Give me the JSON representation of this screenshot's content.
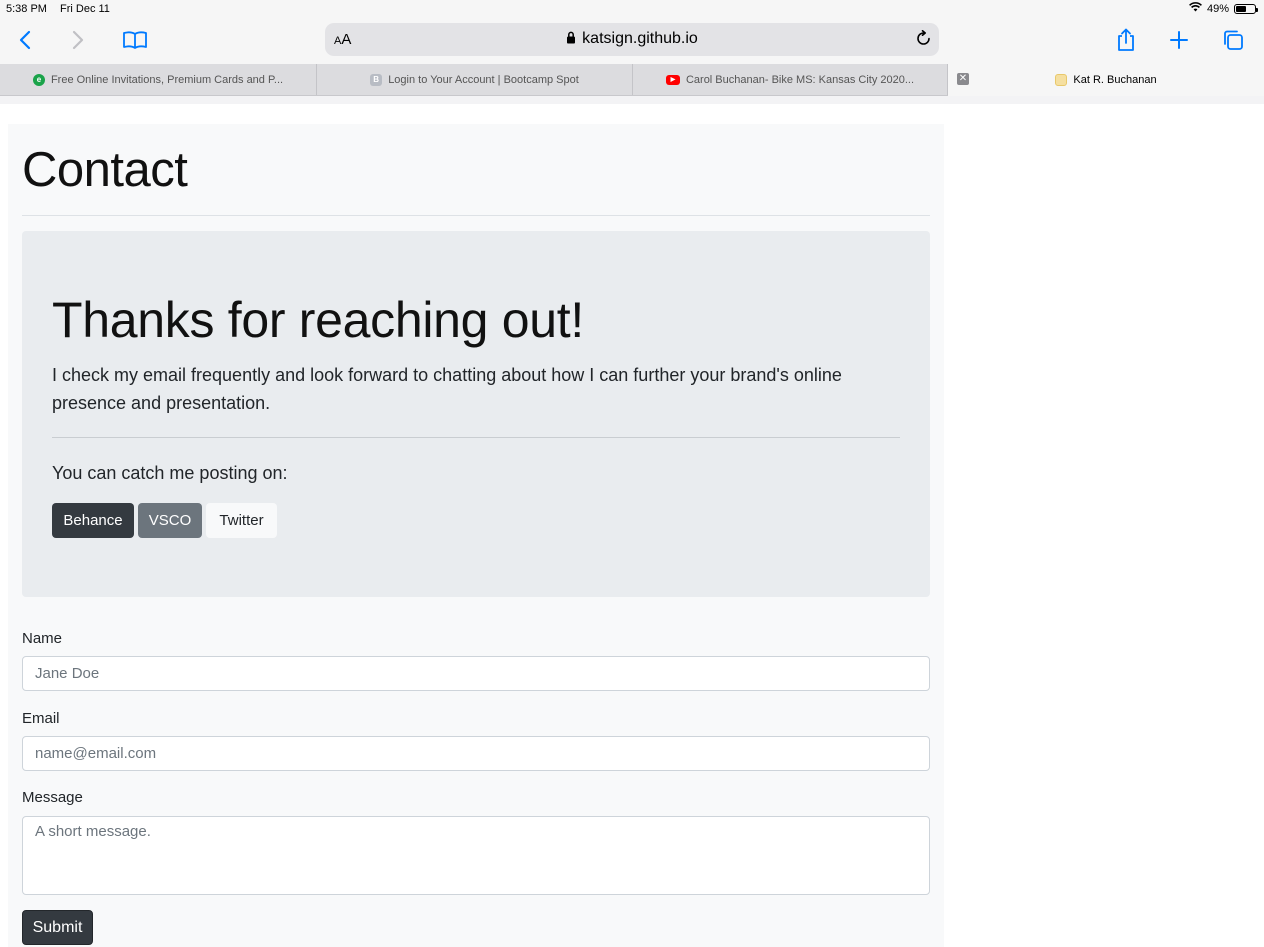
{
  "status": {
    "time": "5:38 PM",
    "date": "Fri Dec 11",
    "battery": "49%"
  },
  "address": {
    "aa_small": "A",
    "aa_big": "A",
    "url": "katsign.github.io"
  },
  "tabs": [
    {
      "label": "Free Online Invitations, Premium Cards and P...",
      "favicon": "e"
    },
    {
      "label": "Login to Your Account | Bootcamp Spot",
      "favicon": "B"
    },
    {
      "label": "Carol Buchanan- Bike MS: Kansas City 2020...",
      "favicon": "▶"
    },
    {
      "label": "Kat R. Buchanan",
      "favicon": ""
    }
  ],
  "page": {
    "title": "Contact",
    "jumbotron": {
      "heading": "Thanks for reaching out!",
      "lead": "I check my email frequently and look forward to chatting about how I can further your brand's online presence and presentation.",
      "catch": "You can catch me posting on:",
      "buttons": {
        "behance": "Behance",
        "vsco": "VSCO",
        "twitter": "Twitter"
      }
    },
    "form": {
      "name_label": "Name",
      "name_placeholder": "Jane Doe",
      "email_label": "Email",
      "email_placeholder": "name@email.com",
      "message_label": "Message",
      "message_placeholder": "A short message.",
      "submit": "Submit"
    }
  },
  "colors": {
    "accent": "#007aff",
    "dark_button": "#343a40",
    "secondary_button": "#6c757d",
    "jumbotron_bg": "#e9ecef"
  }
}
